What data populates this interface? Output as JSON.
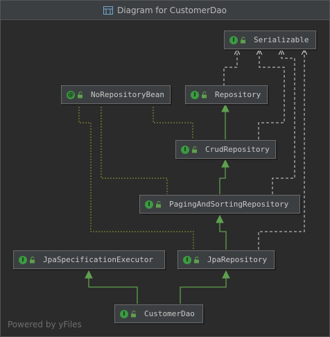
{
  "window": {
    "title": "Diagram for CustomerDao"
  },
  "nodes": {
    "serializable": "Serializable",
    "no_repository_bean": "NoRepositoryBean",
    "repository": "Repository",
    "crud_repository": "CrudRepository",
    "paging_and_sorting_repository": "PagingAndSortingRepository",
    "jpa_specification_executor": "JpaSpecificationExecutor",
    "jpa_repository": "JpaRepository",
    "customer_dao": "CustomerDao"
  },
  "icons": {
    "interface_badge": "I",
    "annotation_badge": "@",
    "interface_icon": "interface-icon",
    "annotation_icon": "annotation-icon",
    "visibility_icon": "unlocked-icon"
  },
  "colors": {
    "background": "#2b2b2b",
    "node_fill": "#3c3f41",
    "extends_edge": "#5fa04e",
    "implements_edge": "#d7d7d7",
    "annotation_edge": "#9a9a3a"
  },
  "footer": {
    "watermark": "Powered by yFiles"
  }
}
